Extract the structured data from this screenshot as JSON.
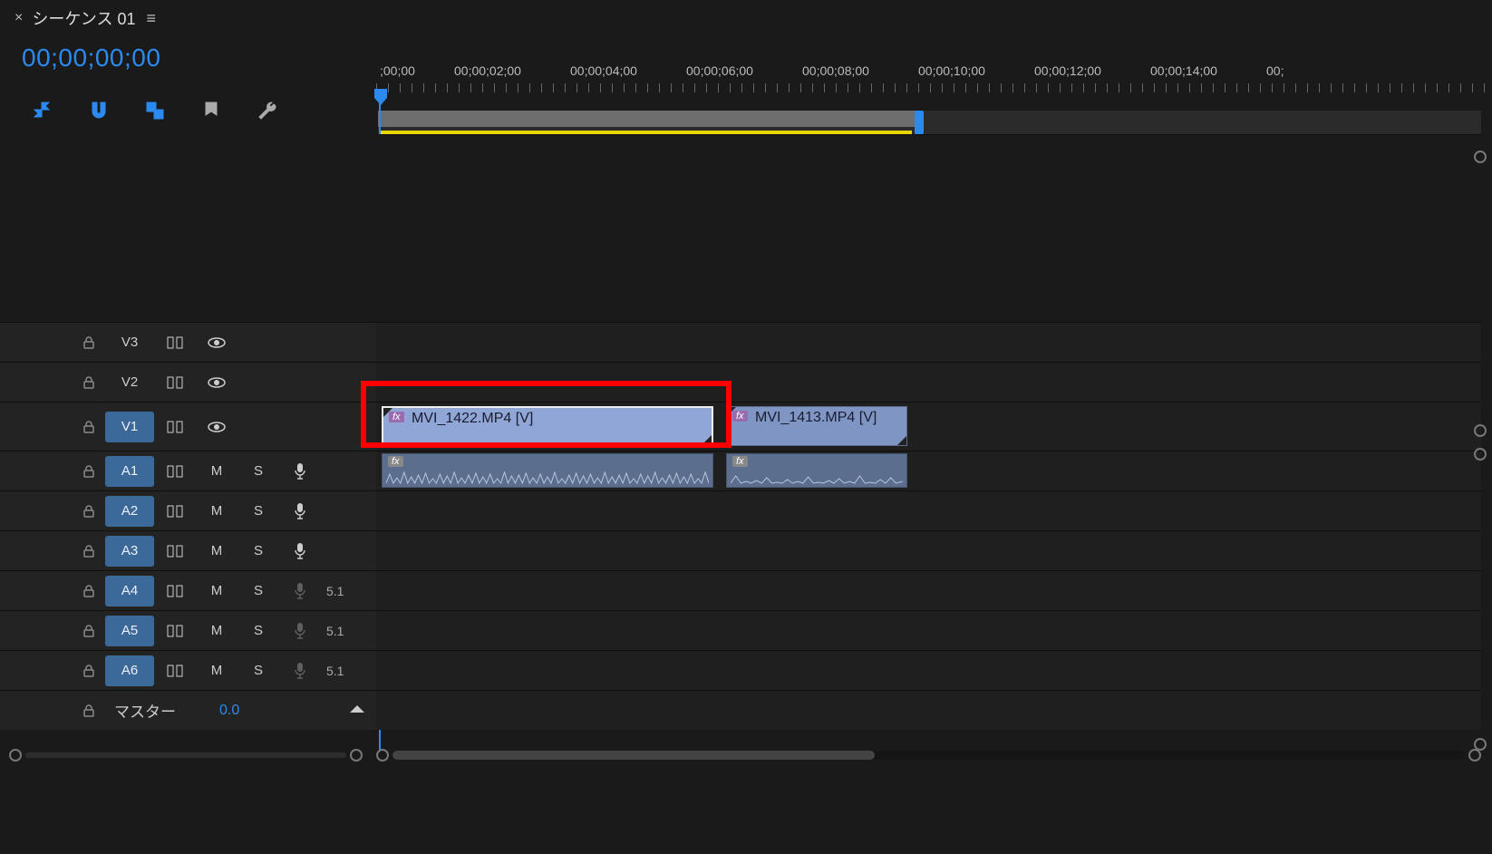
{
  "tab": {
    "title": "シーケンス 01"
  },
  "timecode": "00;00;00;00",
  "ruler_labels": [
    ";00;00",
    "00;00;02;00",
    "00;00;04;00",
    "00;00;06;00",
    "00;00;08;00",
    "00;00;10;00",
    "00;00;12;00",
    "00;00;14;00",
    "00;"
  ],
  "tracks": {
    "video": [
      {
        "id": "V3",
        "selected": false
      },
      {
        "id": "V2",
        "selected": false
      },
      {
        "id": "V1",
        "selected": true
      }
    ],
    "audio": [
      {
        "id": "A1",
        "selected": true,
        "channels": ""
      },
      {
        "id": "A2",
        "selected": true,
        "channels": ""
      },
      {
        "id": "A3",
        "selected": true,
        "channels": ""
      },
      {
        "id": "A4",
        "selected": true,
        "channels": "5.1"
      },
      {
        "id": "A5",
        "selected": true,
        "channels": "5.1"
      },
      {
        "id": "A6",
        "selected": true,
        "channels": "5.1"
      }
    ],
    "master": {
      "label": "マスター",
      "value": "0.0"
    }
  },
  "clips": {
    "v1": [
      {
        "name": "MVI_1422.MP4 [V]",
        "selected": true,
        "highlighted": true
      },
      {
        "name": "MVI_1413.MP4 [V]",
        "selected": false,
        "highlighted": false
      }
    ]
  },
  "controls": {
    "M": "M",
    "S": "S"
  }
}
